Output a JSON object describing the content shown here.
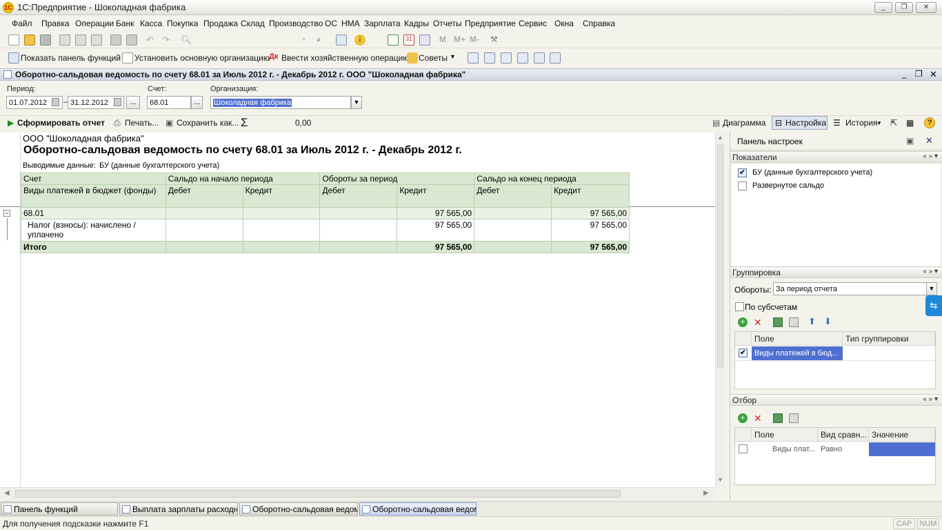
{
  "window": {
    "title": "1С:Предприятие - Шоколадная фабрика",
    "app_icon": "1С",
    "minimize": "_",
    "restore": "❐",
    "close": "✕"
  },
  "menu": [
    "Файл",
    "Правка",
    "Операции",
    "Банк",
    "Касса",
    "Покупка",
    "Продажа",
    "Склад",
    "Производство",
    "ОС",
    "НМА",
    "Зарплата",
    "Кадры",
    "Отчеты",
    "Предприятие",
    "Сервис",
    "Окна",
    "Справка"
  ],
  "toolbar2": {
    "show_panel": "Показать панель функций",
    "set_org": "Установить основную организацию",
    "enter_op": "Ввести хозяйственную операцию",
    "tips": "Советы"
  },
  "document": {
    "title": "Оборотно-сальдовая ведомость по счету 68.01 за Июль 2012 г. - Декабрь 2012 г. ООО \"Шоколадная фабрика\""
  },
  "params": {
    "period_label": "Период:",
    "date_from": "01.07.2012",
    "dash": "–",
    "date_to": "31.12.2012",
    "ellipsis": "...",
    "account_label": "Счет:",
    "account": "68.01",
    "org_label": "Организация:",
    "org": "Шоколадная фабрика"
  },
  "actions": {
    "generate": "Сформировать отчет",
    "print": "Печать...",
    "save_as": "Сохранить как...",
    "sum_symbol": "Σ",
    "sum_value": "0,00",
    "diagram": "Диаграмма",
    "settings": "Настройка",
    "history": "История"
  },
  "report": {
    "org_name": "ООО \"Шоколадная фабрика\"",
    "title": "Оборотно-сальдовая ведомость по счету 68.01 за Июль 2012 г. - Декабрь 2012 г.",
    "output_label": "Выводимые данные:",
    "output_value": "БУ (данные бухгалтерского учета)",
    "headers": {
      "account": "Счет",
      "open_balance": "Сальдо на начало периода",
      "turnover": "Обороты за период",
      "close_balance": "Сальдо на конец периода",
      "subkonto": "Виды платежей в бюджет (фонды)",
      "debit": "Дебет",
      "credit": "Кредит"
    },
    "group_row": {
      "account": "68.01",
      "turnover_credit": "97 565,00",
      "close_credit": "97 565,00"
    },
    "detail_row": {
      "name": "Налог (взносы): начислено / уплачено",
      "turnover_credit": "97 565,00",
      "close_credit": "97 565,00"
    },
    "total_row": {
      "label": "Итого",
      "turnover_credit": "97 565,00",
      "close_credit": "97 565,00"
    }
  },
  "settings_panel": {
    "title": "Панель настроек",
    "indicators_title": "Показатели",
    "indicator_bu": "БУ (данные бухгалтерского учета)",
    "indicator_expanded": "Развернутое сальдо",
    "grouping_title": "Группировка",
    "turnover_label": "Обороты:",
    "turnover_value": "За период отчета",
    "by_subaccounts": "По субсчетам",
    "grouping_col_field": "Поле",
    "grouping_col_type": "Тип группировки",
    "grouping_row_field": "Виды платежей в бюд...",
    "filter_title": "Отбор",
    "filter_col_field": "Поле",
    "filter_col_compare": "Вид сравн...",
    "filter_col_value": "Значение",
    "filter_row_field": "Виды плат...",
    "filter_row_compare": "Равно",
    "section_controls": "« » ▾"
  },
  "tabs": [
    "Панель функций",
    "Выплата зарплаты расходн...",
    "Оборотно-сальдовая ведом...",
    "Оборотно-сальдовая ведом..."
  ],
  "status": {
    "hint": "Для получения подсказки нажмите F1",
    "cap": "CAP",
    "num": "NUM"
  },
  "colors": {
    "table_header": "#d9e8d0",
    "selection": "#4f6fd0",
    "active_tab": "#cdd8ee"
  }
}
